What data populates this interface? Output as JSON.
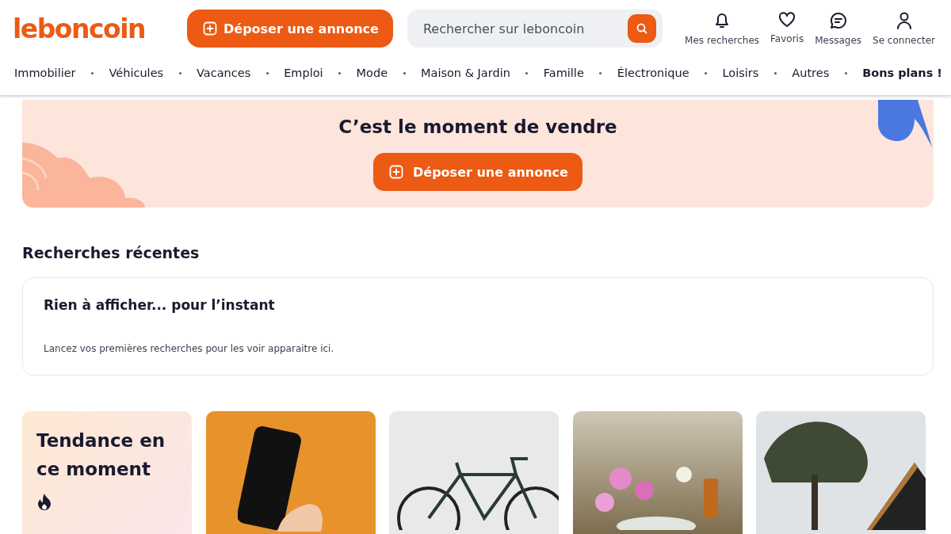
{
  "header": {
    "logo": "leboncoin",
    "post_button": "Déposer une annonce",
    "search": {
      "placeholder": "Rechercher sur leboncoin"
    },
    "actions": [
      {
        "kind": "bell",
        "label": "Mes recherches"
      },
      {
        "kind": "heart",
        "label": "Favoris"
      },
      {
        "kind": "chat",
        "label": "Messages"
      },
      {
        "kind": "person",
        "label": "Se connecter"
      }
    ]
  },
  "categories": [
    {
      "label": "Immobilier",
      "bold": false
    },
    {
      "label": "Véhicules",
      "bold": false
    },
    {
      "label": "Vacances",
      "bold": false
    },
    {
      "label": "Emploi",
      "bold": false
    },
    {
      "label": "Mode",
      "bold": false
    },
    {
      "label": "Maison & Jardin",
      "bold": false
    },
    {
      "label": "Famille",
      "bold": false
    },
    {
      "label": "Électronique",
      "bold": false
    },
    {
      "label": "Loisirs",
      "bold": false
    },
    {
      "label": "Autres",
      "bold": false
    },
    {
      "label": "Bons plans !",
      "bold": true
    }
  ],
  "banner": {
    "title": "C’est le moment de vendre",
    "button": "Déposer une annonce"
  },
  "recent": {
    "heading": "Recherches récentes",
    "empty_title": "Rien à afficher... pour l’instant",
    "empty_text": "Lancez vos premières recherches pour les voir apparaitre ici."
  },
  "trending": {
    "title": "Tendance en ce moment",
    "tiles": [
      {
        "kind": "phone"
      },
      {
        "kind": "bicycle"
      },
      {
        "kind": "flowers"
      },
      {
        "kind": "house"
      }
    ]
  }
}
